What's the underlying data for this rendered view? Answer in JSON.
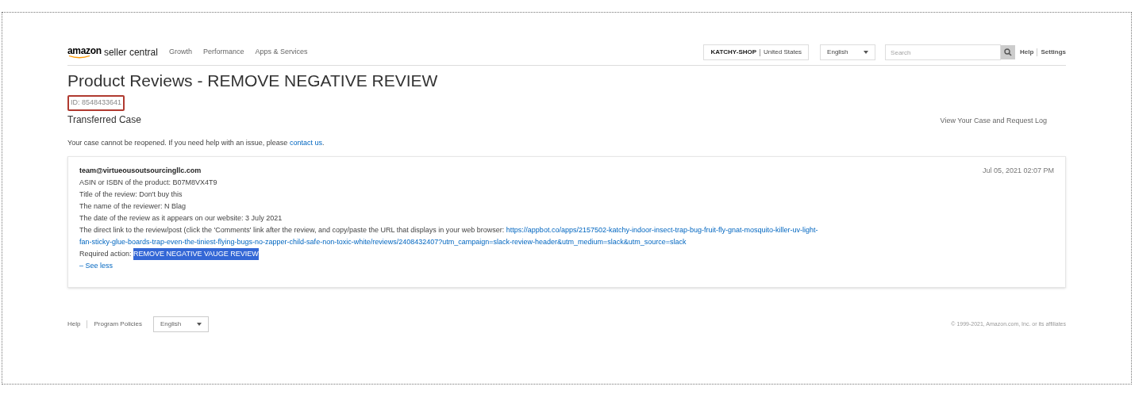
{
  "header": {
    "logo": {
      "brand": "amazon",
      "product": "seller central"
    },
    "nav": [
      "Growth",
      "Performance",
      "Apps & Services"
    ],
    "account": {
      "shop": "KATCHY-SHOP",
      "region": "United States"
    },
    "language": "English",
    "search": {
      "placeholder": "Search"
    },
    "links": [
      "Help",
      "Settings"
    ]
  },
  "case": {
    "title": "Product Reviews - REMOVE NEGATIVE REVIEW",
    "id": {
      "text": "ID: 8548433641",
      "highlighted": true
    },
    "subtitle": "Transferred Case",
    "log_link": "View Your Case and Request Log",
    "notice": {
      "text": "Your case cannot be reopened. If you need help with an issue, please ",
      "link": "contact us",
      "end": "."
    }
  },
  "message": {
    "sender": "team@virtueousoutsourcingllc.com",
    "date": "Jul 05, 2021 02:07 PM",
    "lines": [
      "ASIN or ISBN of the product: B07M8VX4T9",
      "Title of the review: Don't buy this",
      "The name of the reviewer: N Blag",
      "The date of the review as it appears on our website: 3 July 2021"
    ],
    "link_line": {
      "text": "The direct link to the review/post (click the 'Comments' link after the review, and copy/paste the URL that displays in your web browser: ",
      "url_lines": [
        "https://appbot.co/apps/2157502-katchy-indoor-insect-trap-bug-fruit-fly-gnat-mosquito-killer-uv-light-",
        "fan-sticky-glue-boards-trap-even-the-tiniest-flying-bugs-no-zapper-child-safe-non-toxic-white/reviews/2408432407?utm_campaign=slack-review-header&utm_medium=slack&utm_source=slack"
      ]
    },
    "action": {
      "label": "Required action: ",
      "value": "REMOVE NEGATIVE VAUGE REVIEW",
      "selected": true
    },
    "toggle": "– See less"
  },
  "footer": {
    "links": [
      "Help",
      "Program Policies"
    ],
    "language": "English",
    "copyright": "© 1999-2021, Amazon.com, Inc. or its affiliates"
  }
}
